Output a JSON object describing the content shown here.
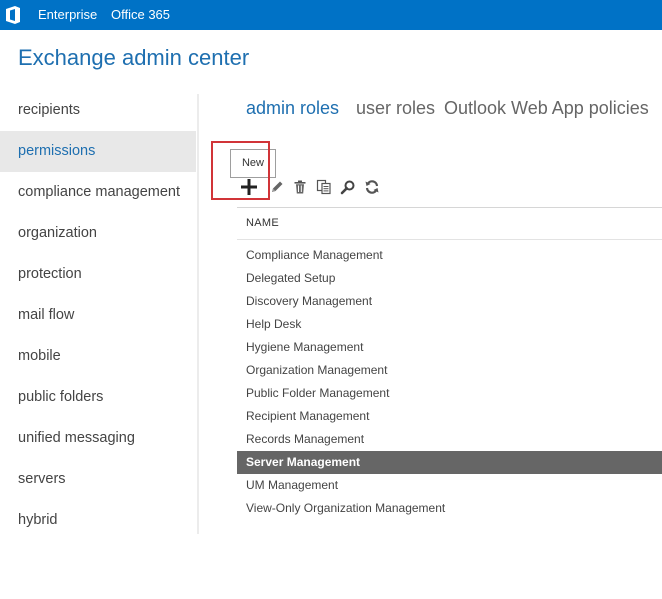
{
  "topbar": {
    "logo_icon": "office-logo-icon",
    "links": [
      "Enterprise",
      "Office 365"
    ],
    "background": "#0072c6"
  },
  "app": {
    "title": "Exchange admin center"
  },
  "sidebar": {
    "items": [
      {
        "label": "recipients",
        "selected": false
      },
      {
        "label": "permissions",
        "selected": true
      },
      {
        "label": "compliance management",
        "selected": false
      },
      {
        "label": "organization",
        "selected": false
      },
      {
        "label": "protection",
        "selected": false
      },
      {
        "label": "mail flow",
        "selected": false
      },
      {
        "label": "mobile",
        "selected": false
      },
      {
        "label": "public folders",
        "selected": false
      },
      {
        "label": "unified messaging",
        "selected": false
      },
      {
        "label": "servers",
        "selected": false
      },
      {
        "label": "hybrid",
        "selected": false
      }
    ]
  },
  "tabs": [
    {
      "label": "admin roles",
      "active": true
    },
    {
      "label": "user roles",
      "active": false
    },
    {
      "label": "Outlook Web App policies",
      "active": false
    }
  ],
  "toolbar": {
    "tooltip": "New",
    "icons": [
      "add-icon",
      "edit-icon",
      "delete-icon",
      "copy-icon",
      "search-icon",
      "refresh-icon"
    ]
  },
  "table": {
    "column_header": "NAME",
    "rows": [
      {
        "name": "Compliance Management",
        "selected": false
      },
      {
        "name": "Delegated Setup",
        "selected": false
      },
      {
        "name": "Discovery Management",
        "selected": false
      },
      {
        "name": "Help Desk",
        "selected": false
      },
      {
        "name": "Hygiene Management",
        "selected": false
      },
      {
        "name": "Organization Management",
        "selected": false
      },
      {
        "name": "Public Folder Management",
        "selected": false
      },
      {
        "name": "Recipient Management",
        "selected": false
      },
      {
        "name": "Records Management",
        "selected": false
      },
      {
        "name": "Server Management",
        "selected": true
      },
      {
        "name": "UM Management",
        "selected": false
      },
      {
        "name": "View-Only Organization Management",
        "selected": false
      }
    ]
  },
  "colors": {
    "accent": "#1e6fb0",
    "selected_row": "#666666",
    "highlight_box": "#d13438"
  }
}
